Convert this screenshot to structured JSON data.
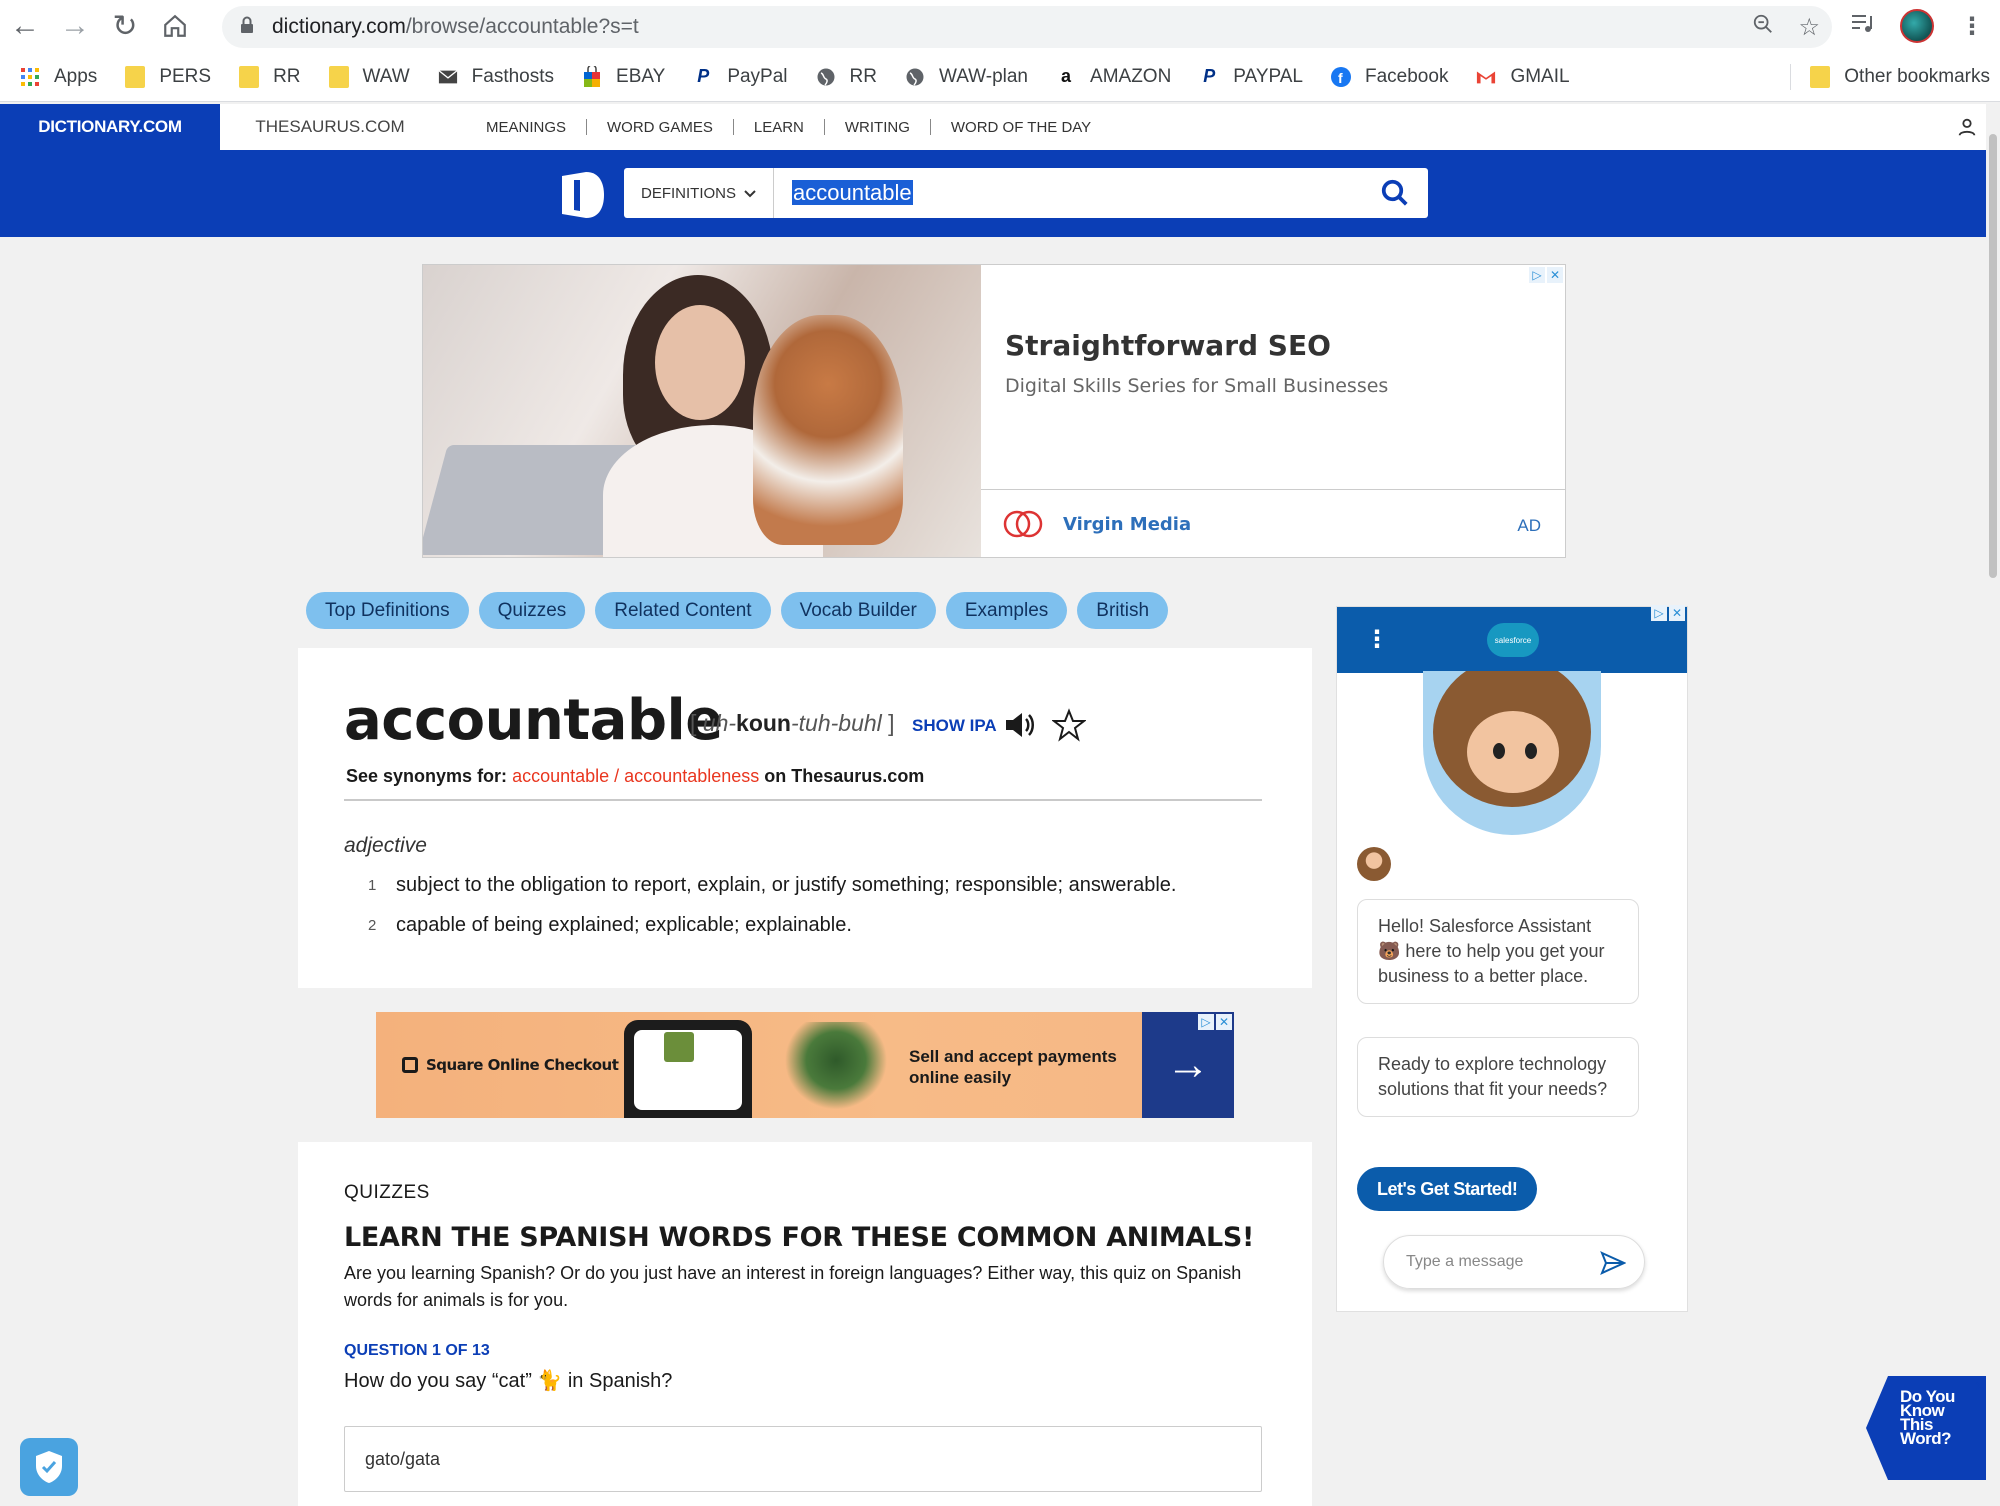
{
  "browser": {
    "url_host": "dictionary.com",
    "url_path": "/browse/accountable?s=t",
    "bookmarks": [
      {
        "label": "Apps",
        "icon": "apps-grid-icon"
      },
      {
        "label": "PERS",
        "icon": "folder-icon"
      },
      {
        "label": "RR",
        "icon": "folder-icon"
      },
      {
        "label": "WAW",
        "icon": "folder-icon"
      },
      {
        "label": "Fasthosts",
        "icon": "mail-icon"
      },
      {
        "label": "EBAY",
        "icon": "ebay-bag-icon"
      },
      {
        "label": "PayPal",
        "icon": "paypal-icon"
      },
      {
        "label": "RR",
        "icon": "globe-icon"
      },
      {
        "label": "WAW-plan",
        "icon": "globe-icon"
      },
      {
        "label": "AMAZON",
        "icon": "amazon-icon"
      },
      {
        "label": "PAYPAL",
        "icon": "paypal-icon"
      },
      {
        "label": "Facebook",
        "icon": "facebook-icon"
      },
      {
        "label": "GMAIL",
        "icon": "gmail-icon"
      }
    ],
    "other_bookmarks": "Other bookmarks"
  },
  "site_nav": {
    "brand": "DICTIONARY.COM",
    "thesaurus": "THESAURUS.COM",
    "links": [
      "MEANINGS",
      "WORD GAMES",
      "LEARN",
      "WRITING",
      "WORD OF THE DAY"
    ]
  },
  "search": {
    "mode": "DEFINITIONS",
    "query": "accountable"
  },
  "ad_top": {
    "title": "Straightforward SEO",
    "subtitle": "Digital Skills Series for Small Businesses",
    "brand": "Virgin Media",
    "tag": "AD"
  },
  "pills": [
    "Top Definitions",
    "Quizzes",
    "Related Content",
    "Vocab Builder",
    "Examples",
    "British"
  ],
  "entry": {
    "headword": "accountable",
    "pron_open": "[",
    "pron_1": "uh-",
    "pron_stress": "koun",
    "pron_2": "-tuh-buhl",
    "pron_close": "]",
    "show_ipa": "SHOW IPA",
    "syn_prefix": "See synonyms for:",
    "syn_words": "accountable / accountableness",
    "syn_suffix": "on Thesaurus.com",
    "pos": "adjective",
    "senses": [
      {
        "num": "1",
        "text": "subject to the obligation to report, explain, or justify something; responsible; answerable."
      },
      {
        "num": "2",
        "text": "capable of being explained; explicable; explainable."
      }
    ]
  },
  "ad_square": {
    "brand": "Square Online Checkout",
    "line1": "Sell and accept payments",
    "line2": "online easily"
  },
  "quiz": {
    "label": "QUIZZES",
    "title": "LEARN THE SPANISH WORDS FOR THESE COMMON ANIMALS!",
    "description": "Are you learning Spanish? Or do you just have an interest in foreign languages? Either way, this quiz on Spanish words for animals is for you.",
    "question_number": "QUESTION 1 OF 13",
    "question": "How do you say “cat” 🐈 in Spanish?",
    "option_1": "gato/gata"
  },
  "salesforce": {
    "logo_text": "salesforce",
    "bubble_1": "Hello! Salesforce Assistant 🐻 here to help you get your business to a better place.",
    "bubble_2": "Ready to explore technology solutions that fit your needs?",
    "cta": "Let's Get Started!",
    "input_placeholder": "Type a message"
  },
  "word_widget": {
    "line1": "Do You",
    "line2": "Know",
    "line3": "This",
    "line4": "Word?"
  },
  "colors": {
    "brand_blue": "#0b3eb6",
    "pill_blue": "#7ec0ee",
    "synonym_red": "#e9361f",
    "salesforce_blue": "#0b5cab"
  }
}
